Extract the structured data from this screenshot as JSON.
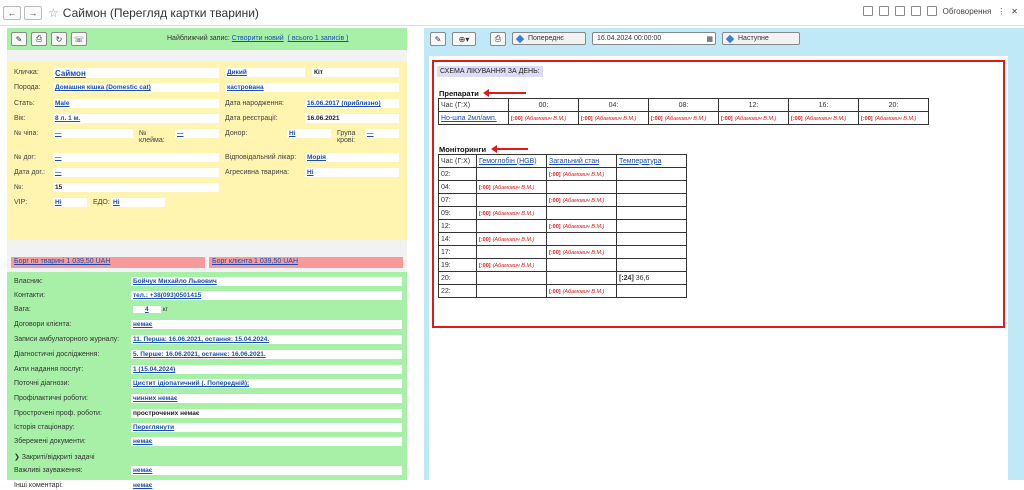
{
  "window": {
    "title": "Саймон (Перегляд картки тварини)",
    "discussions": "Обговорення"
  },
  "left_toolbar": {
    "nearest_label": "Найближчий запис:",
    "create_new": "Створити новий",
    "all_records": "( всього 1 записів )"
  },
  "card": {
    "nickname_label": "Кличка:",
    "nickname": "Саймон",
    "flag1": "Дикий",
    "species": "Кіт",
    "breed_label": "Порода:",
    "breed": "Домашня кішка (Domestic cat)",
    "status2": "кастрована",
    "sex_label": "Стать:",
    "sex": "Male",
    "birth_label": "Дата народження:",
    "birth": "16.06.2017 (приблизно)",
    "age_label": "Вік:",
    "age": "8 л. 1 м.",
    "reg_label": "Дата реєстрації:",
    "reg": "16.06.2021",
    "chip_label": "№ чіпа:",
    "chip": "—",
    "brand_label": "№ клейма:",
    "brand": "—",
    "donor_label": "Донор:",
    "donor": "Ні",
    "blood_label": "Група крові:",
    "blood": "—",
    "contract_label": "№ дог:",
    "contract": "—",
    "doctor_label": "Відповідальний лікар:",
    "doctor": "Морія",
    "contract_date_label": "Дата дог.:",
    "contract_date": "—",
    "aggressive_label": "Агресивна тварина:",
    "aggressive": "Ні",
    "num_label": "№:",
    "num": "15",
    "vip_label": "VIP:",
    "vip": "Ні",
    "edo_label": "ЕДО:",
    "edo": "Ні"
  },
  "debts": {
    "animal": "Борг по тварині 1 039,50 UAH",
    "client": "Борг клієнта 1 039,50 UAH"
  },
  "owner": {
    "rows": [
      {
        "label": "Власник:",
        "value": "Бойчук Михайло Львович",
        "link": true
      },
      {
        "label": "Контакти:",
        "value": "тел.: +38(093)0501415",
        "link": true
      },
      {
        "label": "Вага:",
        "value": "4",
        "link": true
      },
      {
        "label": "Договори клієнта:",
        "value": "немає",
        "link": true
      },
      {
        "label": "Записи амбулаторного журналу:",
        "value": "11. Перша: 16.06.2021, остання: 15.04.2024.",
        "link": true
      },
      {
        "label": "Діагностичні дослідження:",
        "value": "5. Перше: 16.06.2021, останнє: 16.06.2021.",
        "link": true
      },
      {
        "label": "Акти надання послуг:",
        "value": "1 (15.04.2024)",
        "link": true
      },
      {
        "label": "Поточні діагнози:",
        "value": "Цистит ідіопатичний (. Попередній);",
        "link": true
      },
      {
        "label": "Профілактичні роботи:",
        "value": "чинних немає",
        "link": true
      },
      {
        "label": "Прострочені проф. роботи:",
        "value": "прострочених немає",
        "link": false
      },
      {
        "label": "Історія стаціонару:",
        "value": "Переглянути",
        "link": true
      },
      {
        "label": "Збережені документи:",
        "value": "немає",
        "link": true
      },
      {
        "label": "Закриті/відкриті задачі",
        "value": "",
        "link": false
      },
      {
        "label": "Важливі зауваження:",
        "value": "немає",
        "link": true
      },
      {
        "label": "Інші коментарі:",
        "value": "немає",
        "link": true
      }
    ],
    "weight_unit": "кг"
  },
  "right_toolbar": {
    "prev": "Попереднє",
    "date": "16.04.2024 00:00:00",
    "next": "Наступне"
  },
  "schema": {
    "title": "СХЕМА ЛІКУВАННЯ ЗА ДЕНЬ:",
    "drugs_title": "Препарати",
    "drugs_header": [
      "Час (Г:Х)",
      "00:",
      "04:",
      "08:",
      "12:",
      "16:",
      "20:"
    ],
    "drug_name": "Но-шпа 2мл/амп.",
    "drug_cell_time": "[:00]",
    "drug_cell_who": "(Абамович В.М.)",
    "mon_title": "Моніторинги",
    "mon_header": [
      "Час (Г:Х)",
      "Гемоглобін (HGB)",
      "Загальний стан",
      "Температура"
    ],
    "mon_rows": [
      {
        "t": "02:",
        "c": [
          "",
          "[:00]",
          ""
        ]
      },
      {
        "t": "04:",
        "c": [
          "[:00]",
          "",
          ""
        ]
      },
      {
        "t": "07:",
        "c": [
          "",
          "[:00]",
          ""
        ]
      },
      {
        "t": "09:",
        "c": [
          "[:00]",
          "",
          ""
        ]
      },
      {
        "t": "12:",
        "c": [
          "",
          "[:00]",
          ""
        ]
      },
      {
        "t": "14:",
        "c": [
          "[:00]",
          "",
          ""
        ]
      },
      {
        "t": "17:",
        "c": [
          "",
          "[:00]",
          ""
        ]
      },
      {
        "t": "19:",
        "c": [
          "[:00]",
          "",
          ""
        ]
      },
      {
        "t": "20:",
        "c": [
          "",
          "",
          "[:24] 36,6"
        ]
      },
      {
        "t": "22:",
        "c": [
          "",
          "[:00]",
          ""
        ]
      }
    ]
  }
}
